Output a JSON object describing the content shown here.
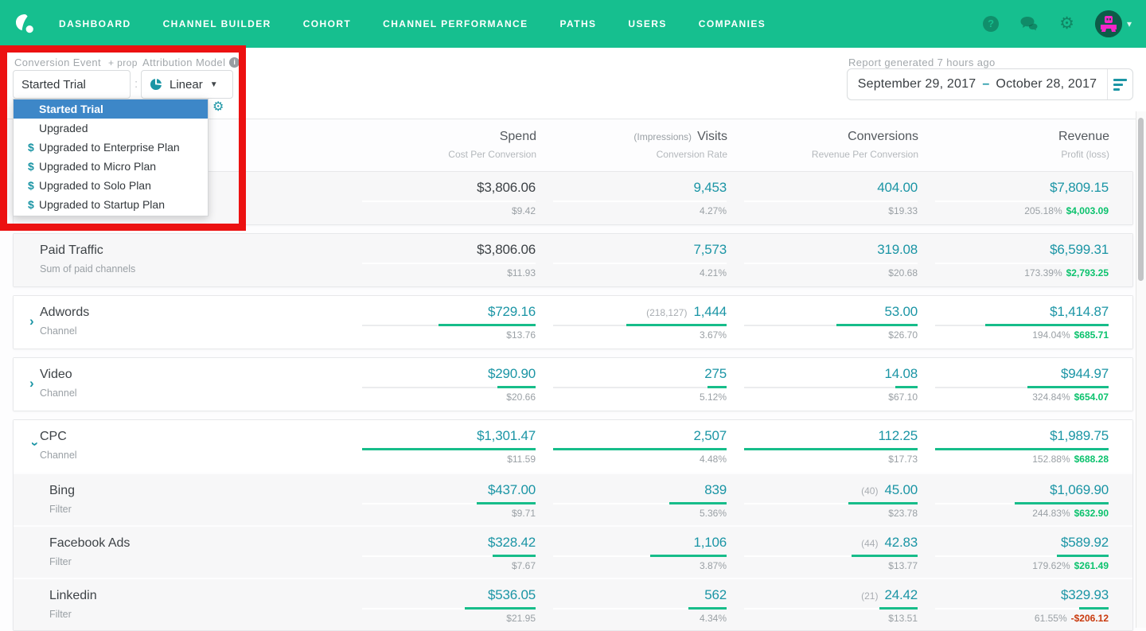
{
  "colors": {
    "brand_green": "#16bf8f",
    "value_teal": "#1b95a5",
    "bar_green": "#17bd8a",
    "profit_green": "#0bc26d",
    "loss_red": "#c93a0e",
    "selected_blue": "#3d87c8",
    "annotation_red": "#ec1111"
  },
  "nav": {
    "items": [
      "DASHBOARD",
      "CHANNEL BUILDER",
      "COHORT",
      "CHANNEL PERFORMANCE",
      "PATHS",
      "USERS",
      "COMPANIES"
    ],
    "right_icons": [
      "help-icon",
      "chat-icon",
      "gear-icon",
      "avatar",
      "chevron-down-icon"
    ]
  },
  "filters": {
    "conversion_event_label": "Conversion Event",
    "prop_label": "+ prop",
    "conversion_event_value": "Started Trial",
    "separator": ":",
    "attribution_model_label": "Attribution Model",
    "attribution_model_value": "Linear",
    "report_generated": "Report generated 7 hours ago",
    "date_start": "September 29, 2017",
    "date_range_separator": "–",
    "date_end": "October 28, 2017"
  },
  "hidden_controls": {
    "separator": ":",
    "icon": "gear-icon"
  },
  "conversion_dropdown": {
    "items": [
      {
        "label": "Started Trial",
        "money": false,
        "selected": true
      },
      {
        "label": "Upgraded",
        "money": false,
        "selected": false
      },
      {
        "label": "Upgraded to Enterprise Plan",
        "money": true,
        "selected": false
      },
      {
        "label": "Upgraded to Micro Plan",
        "money": true,
        "selected": false
      },
      {
        "label": "Upgraded to Solo Plan",
        "money": true,
        "selected": false
      },
      {
        "label": "Upgraded to Startup Plan",
        "money": true,
        "selected": false
      }
    ]
  },
  "table": {
    "column_keys": [
      "spend",
      "visits",
      "conversions",
      "revenue"
    ],
    "header": [
      {
        "prefix": "",
        "label": "Spend",
        "sublabel": "Cost Per Conversion"
      },
      {
        "prefix": "(Impressions)",
        "label": "Visits",
        "sublabel": "Conversion Rate"
      },
      {
        "prefix": "",
        "label": "Conversions",
        "sublabel": "Revenue Per Conversion"
      },
      {
        "prefix": "",
        "label": "Revenue",
        "sublabel": "Profit (loss)"
      }
    ],
    "cards": [
      {
        "card": "summary",
        "rows": [
          {
            "name": "",
            "subname": "",
            "gray": true,
            "filter": false,
            "chevron": null,
            "interactable": false,
            "cells": [
              {
                "value": "$3,806.06",
                "sub": "$9.42",
                "bar": 0,
                "dark": true
              },
              {
                "value": "9,453",
                "sub": "4.27%",
                "bar": 0
              },
              {
                "value": "404.00",
                "sub": "$19.33",
                "bar": 0
              },
              {
                "value": "$7,809.15",
                "pct": "205.18%",
                "profit": "$4,003.09",
                "negative": false,
                "bar": 0
              }
            ]
          }
        ]
      },
      {
        "card": "summary",
        "rows": [
          {
            "name": "Paid Traffic",
            "subname": "Sum of paid channels",
            "gray": true,
            "filter": false,
            "chevron": null,
            "interactable": false,
            "cells": [
              {
                "value": "$3,806.06",
                "sub": "$11.93",
                "bar": 0,
                "dark": true
              },
              {
                "value": "7,573",
                "sub": "4.21%",
                "bar": 0
              },
              {
                "value": "319.08",
                "sub": "$20.68",
                "bar": 0
              },
              {
                "value": "$6,599.31",
                "pct": "173.39%",
                "profit": "$2,793.25",
                "negative": false,
                "bar": 0
              }
            ]
          }
        ]
      },
      {
        "card": "channel",
        "rows": [
          {
            "name": "Adwords",
            "subname": "Channel",
            "gray": false,
            "filter": false,
            "chevron": "right",
            "interactable": true,
            "cells": [
              {
                "value": "$729.16",
                "sub": "$13.76",
                "bar": 56
              },
              {
                "prefix": "(218,127)",
                "value": "1,444",
                "sub": "3.67%",
                "bar": 58
              },
              {
                "value": "53.00",
                "sub": "$26.70",
                "bar": 47
              },
              {
                "value": "$1,414.87",
                "pct": "194.04%",
                "profit": "$685.71",
                "negative": false,
                "bar": 71
              }
            ]
          }
        ]
      },
      {
        "card": "channel",
        "rows": [
          {
            "name": "Video",
            "subname": "Channel",
            "gray": false,
            "filter": false,
            "chevron": "right",
            "interactable": true,
            "cells": [
              {
                "value": "$290.90",
                "sub": "$20.66",
                "bar": 22
              },
              {
                "value": "275",
                "sub": "5.12%",
                "bar": 11
              },
              {
                "value": "14.08",
                "sub": "$67.10",
                "bar": 13
              },
              {
                "value": "$944.97",
                "pct": "324.84%",
                "profit": "$654.07",
                "negative": false,
                "bar": 47
              }
            ]
          }
        ]
      },
      {
        "card": "group",
        "rows": [
          {
            "name": "CPC",
            "subname": "Channel",
            "gray": false,
            "filter": false,
            "chevron": "down",
            "interactable": true,
            "cells": [
              {
                "value": "$1,301.47",
                "sub": "$11.59",
                "bar": 100
              },
              {
                "value": "2,507",
                "sub": "4.48%",
                "bar": 100
              },
              {
                "value": "112.25",
                "sub": "$17.73",
                "bar": 100
              },
              {
                "value": "$1,989.75",
                "pct": "152.88%",
                "profit": "$688.28",
                "negative": false,
                "bar": 100
              }
            ]
          },
          {
            "name": "Bing",
            "subname": "Filter",
            "gray": true,
            "filter": true,
            "chevron": null,
            "interactable": true,
            "cells": [
              {
                "value": "$437.00",
                "sub": "$9.71",
                "bar": 34
              },
              {
                "value": "839",
                "sub": "5.36%",
                "bar": 33
              },
              {
                "prefix": "(40)",
                "value": "45.00",
                "sub": "$23.78",
                "bar": 40
              },
              {
                "value": "$1,069.90",
                "pct": "244.83%",
                "profit": "$632.90",
                "negative": false,
                "bar": 54
              }
            ]
          },
          {
            "name": "Facebook Ads",
            "subname": "Filter",
            "gray": true,
            "filter": true,
            "chevron": null,
            "interactable": true,
            "cells": [
              {
                "value": "$328.42",
                "sub": "$7.67",
                "bar": 25
              },
              {
                "value": "1,106",
                "sub": "3.87%",
                "bar": 44
              },
              {
                "prefix": "(44)",
                "value": "42.83",
                "sub": "$13.77",
                "bar": 38
              },
              {
                "value": "$589.92",
                "pct": "179.62%",
                "profit": "$261.49",
                "negative": false,
                "bar": 30
              }
            ]
          },
          {
            "name": "Linkedin",
            "subname": "Filter",
            "gray": true,
            "filter": true,
            "chevron": null,
            "interactable": true,
            "cells": [
              {
                "value": "$536.05",
                "sub": "$21.95",
                "bar": 41
              },
              {
                "value": "562",
                "sub": "4.34%",
                "bar": 22
              },
              {
                "prefix": "(21)",
                "value": "24.42",
                "sub": "$13.51",
                "bar": 22
              },
              {
                "value": "$329.93",
                "pct": "61.55%",
                "profit": "-$206.12",
                "negative": true,
                "bar": 17
              }
            ]
          }
        ]
      }
    ]
  }
}
